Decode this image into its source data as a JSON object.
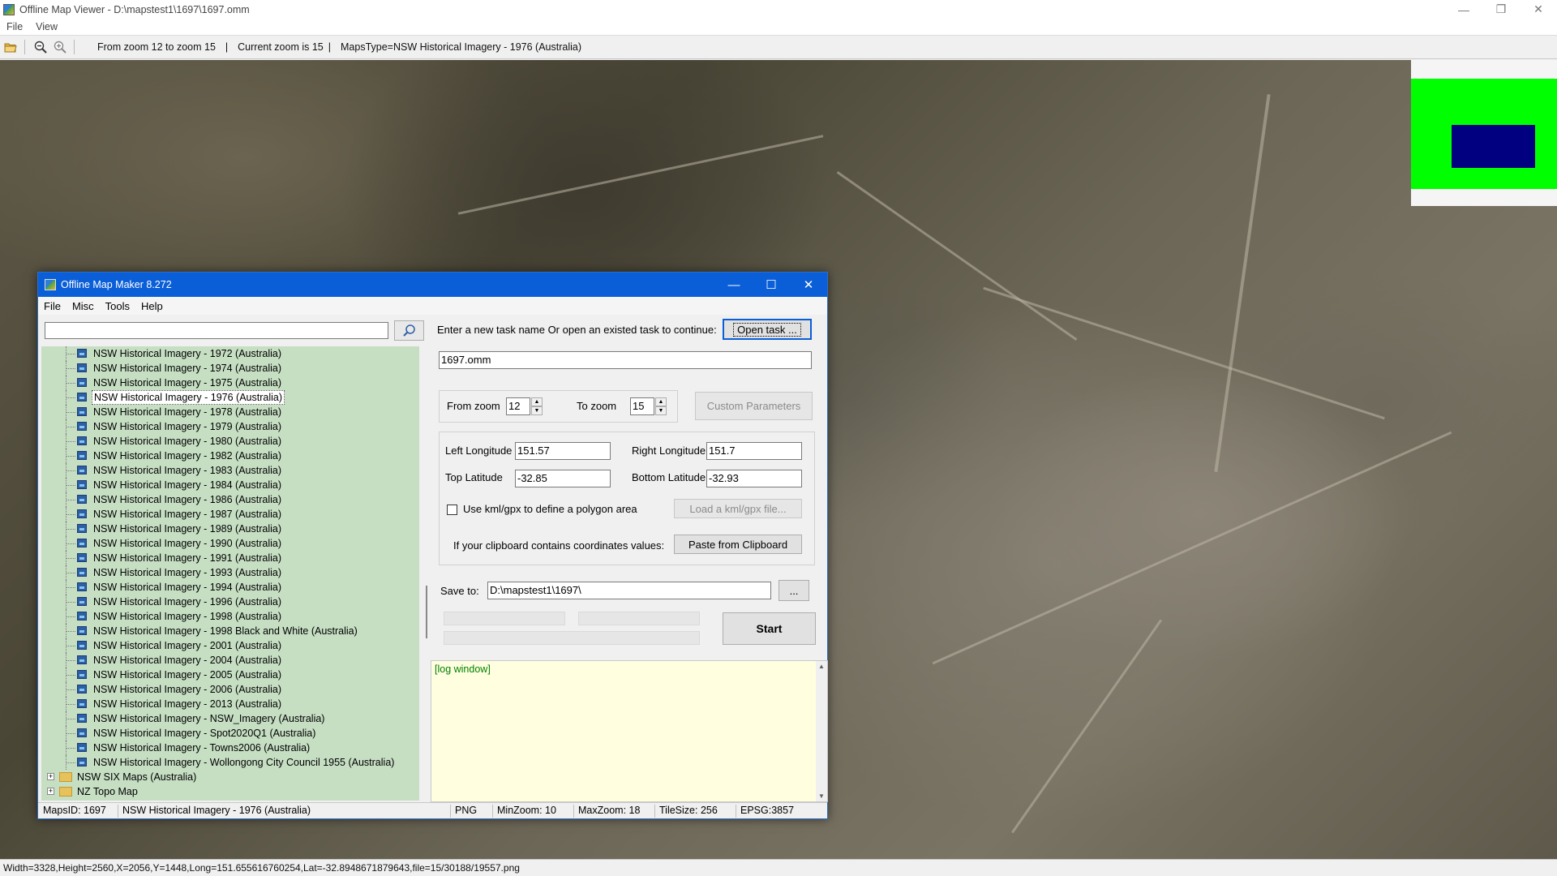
{
  "app": {
    "title": "Offline Map Viewer - D:\\mapstest1\\1697\\1697.omm",
    "window_buttons": [
      "—",
      "❐",
      "✕"
    ]
  },
  "menu": [
    "File",
    "View"
  ],
  "toolbar": {
    "zoom_range": "From zoom 12 to zoom 15",
    "current_zoom": "Current zoom is 15",
    "maps_type": "MapsType=NSW Historical Imagery - 1976 (Australia)",
    "separator": "|"
  },
  "status_bar": "Width=3328,Height=2560,X=2056,Y=1448,Long=151.655616760254,Lat=-32.8948671879643,file=15/30188/19557.png",
  "minimap": {
    "bg_color": "#00ff00",
    "viewport_color": "#000080"
  },
  "dialog": {
    "title": "Offline Map Maker 8.272",
    "window_buttons": [
      "—",
      "☐",
      "✕"
    ],
    "menu": [
      "File",
      "Misc",
      "Tools",
      "Help"
    ],
    "search": {
      "value": ""
    },
    "tree": {
      "items": [
        "NSW Historical Imagery - 1972 (Australia)",
        "NSW Historical Imagery - 1974 (Australia)",
        "NSW Historical Imagery - 1975 (Australia)",
        "NSW Historical Imagery - 1976 (Australia)",
        "NSW Historical Imagery - 1978 (Australia)",
        "NSW Historical Imagery - 1979 (Australia)",
        "NSW Historical Imagery - 1980 (Australia)",
        "NSW Historical Imagery - 1982 (Australia)",
        "NSW Historical Imagery - 1983 (Australia)",
        "NSW Historical Imagery - 1984 (Australia)",
        "NSW Historical Imagery - 1986 (Australia)",
        "NSW Historical Imagery - 1987 (Australia)",
        "NSW Historical Imagery - 1989 (Australia)",
        "NSW Historical Imagery - 1990 (Australia)",
        "NSW Historical Imagery - 1991 (Australia)",
        "NSW Historical Imagery - 1993 (Australia)",
        "NSW Historical Imagery - 1994 (Australia)",
        "NSW Historical Imagery - 1996 (Australia)",
        "NSW Historical Imagery - 1998 (Australia)",
        "NSW Historical Imagery - 1998 Black and White (Australia)",
        "NSW Historical Imagery - 2001 (Australia)",
        "NSW Historical Imagery - 2004 (Australia)",
        "NSW Historical Imagery - 2005 (Australia)",
        "NSW Historical Imagery - 2006 (Australia)",
        "NSW Historical Imagery - 2013 (Australia)",
        "NSW Historical Imagery - NSW_Imagery (Australia)",
        "NSW Historical Imagery - Spot2020Q1 (Australia)",
        "NSW Historical Imagery - Towns2006 (Australia)",
        "NSW Historical Imagery - Wollongong City Council 1955 (Australia)"
      ],
      "selected_item": "NSW Historical Imagery - 1976 (Australia)",
      "folders": [
        {
          "label": "NSW SIX Maps (Australia)",
          "expander": "+"
        },
        {
          "label": "NZ Topo Map",
          "expander": "+"
        }
      ]
    },
    "task": {
      "prompt": "Enter a new task name Or open an existed task to continue:",
      "open_button": "Open task ...",
      "task_name": "1697.omm"
    },
    "zoom": {
      "from_label": "From zoom",
      "from_value": "12",
      "to_label": "To zoom",
      "to_value": "15",
      "custom_button": "Custom Parameters"
    },
    "coords": {
      "left_lon_label": "Left Longitude",
      "left_lon": "151.57",
      "right_lon_label": "Right Longitude",
      "right_lon": "151.7",
      "top_lat_label": "Top Latitude",
      "top_lat": "-32.85",
      "bottom_lat_label": "Bottom Latitude",
      "bottom_lat": "-32.93",
      "kml_checkbox_label": "Use kml/gpx to define a polygon area",
      "kml_checked": false,
      "load_kml_button": "Load a kml/gpx file...",
      "clipboard_label": "If your clipboard contains coordinates values:",
      "paste_button": "Paste from Clipboard"
    },
    "save": {
      "label": "Save to:",
      "path": "D:\\mapstest1\\1697\\",
      "browse_button": "...",
      "start_button": "Start"
    },
    "log": {
      "text": "[log window]"
    },
    "status": {
      "maps_id": "MapsID: 1697",
      "maps_name": "NSW Historical Imagery - 1976 (Australia)",
      "format": "PNG",
      "min_zoom": "MinZoom: 10",
      "max_zoom": "MaxZoom: 18",
      "tile_size": "TileSize: 256",
      "epsg": "EPSG:3857"
    }
  }
}
